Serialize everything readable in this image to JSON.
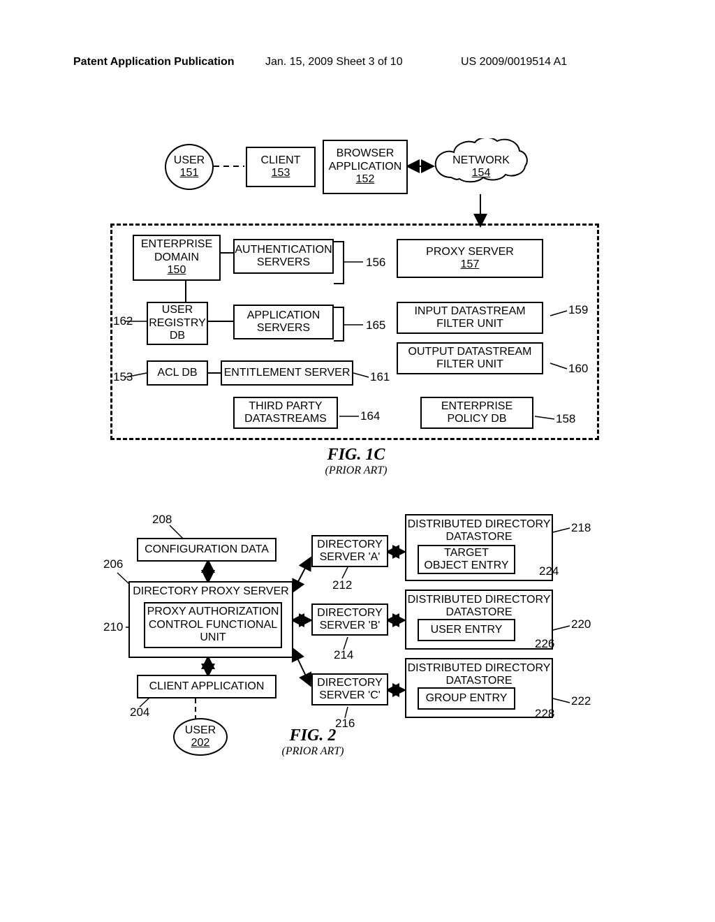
{
  "header": {
    "left": "Patent Application Publication",
    "center": "Jan. 15, 2009  Sheet 3 of 10",
    "right": "US 2009/0019514 A1"
  },
  "fig1c": {
    "caption": {
      "name": "FIG. 1C",
      "sub": "(PRIOR ART)"
    },
    "user": {
      "label": "USER",
      "ref": "151"
    },
    "client": {
      "label": "CLIENT",
      "ref": "153"
    },
    "browser": {
      "l1": "BROWSER",
      "l2": "APPLICATION",
      "ref": "152"
    },
    "network": {
      "label": "NETWORK",
      "ref": "154"
    },
    "entdomain": {
      "l1": "ENTERPRISE",
      "l2": "DOMAIN",
      "ref": "150"
    },
    "authsvr": {
      "l1": "AUTHENTICATION",
      "l2": "SERVERS"
    },
    "proxy": {
      "label": "PROXY SERVER",
      "ref": "157"
    },
    "userreg": {
      "l1": "USER",
      "l2": "REGISTRY",
      "l3": "DB"
    },
    "appsvr": {
      "l1": "APPLICATION",
      "l2": "SERVERS"
    },
    "inputds": {
      "l1": "INPUT DATASTREAM",
      "l2": "FILTER UNIT"
    },
    "outputds": {
      "l1": "OUTPUT DATASTREAM",
      "l2": "FILTER UNIT"
    },
    "acldb": {
      "label": "ACL DB"
    },
    "entsvr": {
      "label": "ENTITLEMENT SERVER"
    },
    "thirdparty": {
      "l1": "THIRD PARTY",
      "l2": "DATASTREAMS"
    },
    "entpolicy": {
      "l1": "ENTERPRISE",
      "l2": "POLICY DB"
    },
    "refs": {
      "r156": "156",
      "r162": "162",
      "r165": "165",
      "r159": "159",
      "r160": "160",
      "r153b": "153",
      "r161": "161",
      "r164": "164",
      "r158": "158"
    }
  },
  "fig2": {
    "caption": {
      "name": "FIG. 2",
      "sub": "(PRIOR ART)"
    },
    "configdata": {
      "label": "CONFIGURATION DATA"
    },
    "dps": {
      "label": "DIRECTORY PROXY SERVER"
    },
    "proxyauth": {
      "l1": "PROXY AUTHORIZATION",
      "l2": "CONTROL FUNCTIONAL",
      "l3": "UNIT"
    },
    "clientapp": {
      "label": "CLIENT APPLICATION"
    },
    "user": {
      "label": "USER",
      "ref": "202"
    },
    "dirA": {
      "l1": "DIRECTORY",
      "l2": "SERVER 'A'"
    },
    "dirB": {
      "l1": "DIRECTORY",
      "l2": "SERVER 'B'"
    },
    "dirC": {
      "l1": "DIRECTORY",
      "l2": "SERVER 'C'"
    },
    "dd1": {
      "l1": "DISTRIBUTED DIRECTORY",
      "l2": "DATASTORE"
    },
    "dd1i": {
      "l1": "TARGET",
      "l2": "OBJECT ENTRY"
    },
    "dd2": {
      "l1": "DISTRIBUTED DIRECTORY",
      "l2": "DATASTORE"
    },
    "dd2i": {
      "label": "USER ENTRY"
    },
    "dd3": {
      "l1": "DISTRIBUTED DIRECTORY",
      "l2": "DATASTORE"
    },
    "dd3i": {
      "label": "GROUP ENTRY"
    },
    "refs": {
      "r208": "208",
      "r206": "206",
      "r210": "210",
      "r204": "204",
      "r212": "212",
      "r214": "214",
      "r216": "216",
      "r218": "218",
      "r224": "224",
      "r220": "220",
      "r226": "226",
      "r222": "222",
      "r228": "228"
    }
  }
}
